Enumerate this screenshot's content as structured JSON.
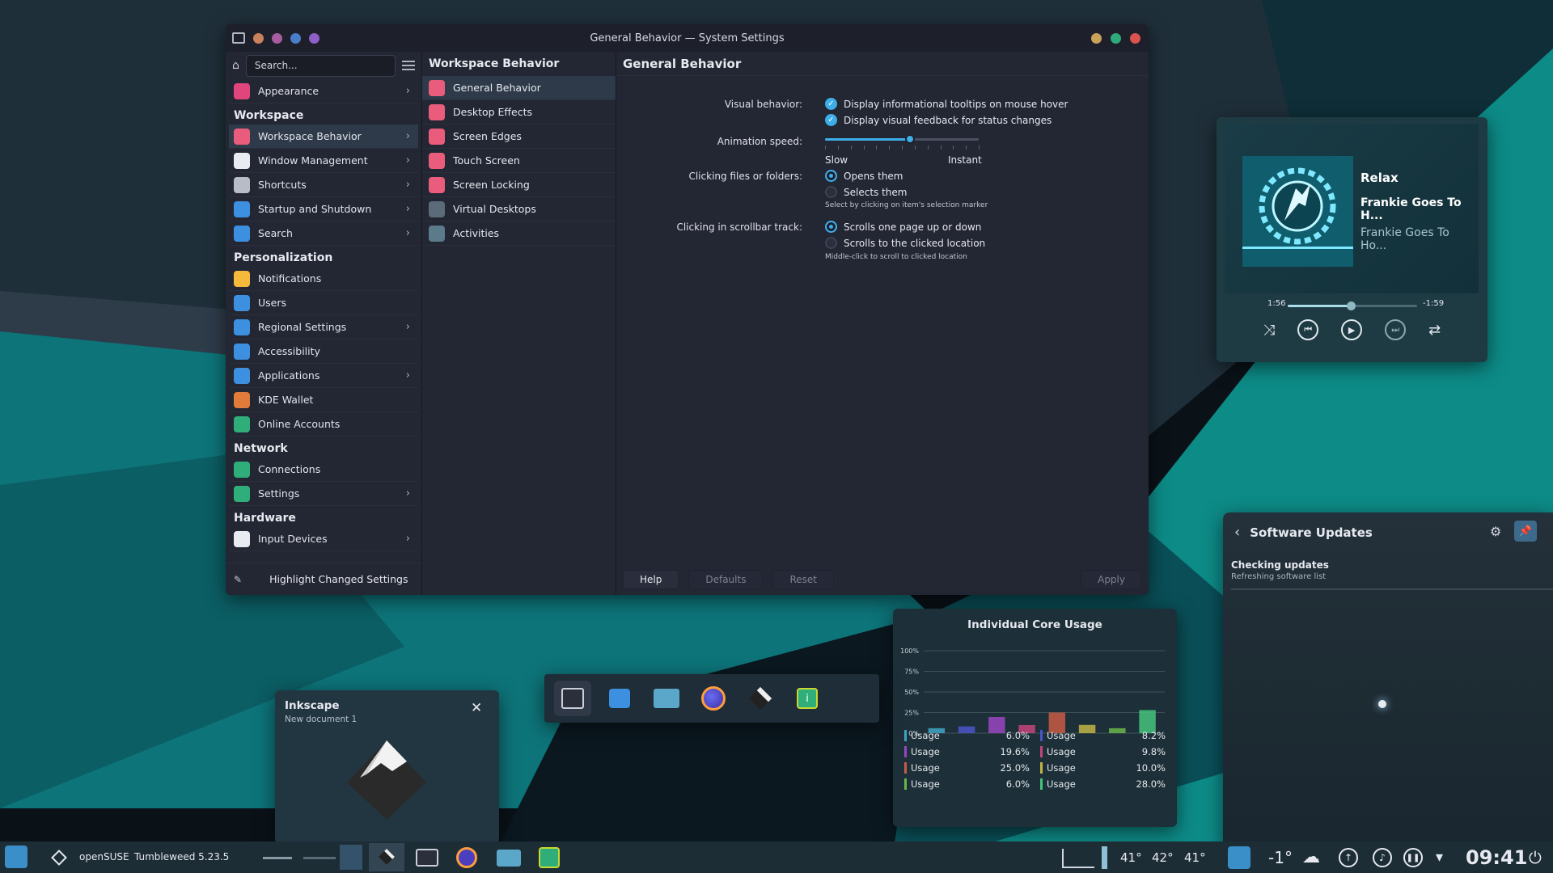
{
  "settings": {
    "title": "General Behavior — System Settings",
    "search_placeholder": "Search...",
    "sidebar": {
      "items": [
        {
          "type": "item",
          "label": "Appearance",
          "chevron": true,
          "color": "#e0457b"
        },
        {
          "type": "category",
          "label": "Workspace"
        },
        {
          "type": "item",
          "label": "Workspace Behavior",
          "chevron": true,
          "selected": true,
          "color": "#e95c7c"
        },
        {
          "type": "item",
          "label": "Window Management",
          "chevron": true,
          "color": "#e8ecf2"
        },
        {
          "type": "item",
          "label": "Shortcuts",
          "chevron": true,
          "color": "#b8bcc6"
        },
        {
          "type": "item",
          "label": "Startup and Shutdown",
          "chevron": true,
          "color": "#3d8fe0"
        },
        {
          "type": "item",
          "label": "Search",
          "chevron": true,
          "color": "#3d8fe0"
        },
        {
          "type": "category",
          "label": "Personalization"
        },
        {
          "type": "item",
          "label": "Notifications",
          "chevron": false,
          "color": "#f6b93b"
        },
        {
          "type": "item",
          "label": "Users",
          "chevron": false,
          "color": "#3d8fe0"
        },
        {
          "type": "item",
          "label": "Regional Settings",
          "chevron": true,
          "color": "#3d8fe0"
        },
        {
          "type": "item",
          "label": "Accessibility",
          "chevron": false,
          "color": "#3d8fe0"
        },
        {
          "type": "item",
          "label": "Applications",
          "chevron": true,
          "color": "#3d8fe0"
        },
        {
          "type": "item",
          "label": "KDE Wallet",
          "chevron": false,
          "color": "#e07b39"
        },
        {
          "type": "item",
          "label": "Online Accounts",
          "chevron": false,
          "color": "#2fae7a"
        },
        {
          "type": "category",
          "label": "Network"
        },
        {
          "type": "item",
          "label": "Connections",
          "chevron": false,
          "color": "#2fae7a"
        },
        {
          "type": "item",
          "label": "Settings",
          "chevron": true,
          "color": "#2fae7a"
        },
        {
          "type": "category",
          "label": "Hardware"
        },
        {
          "type": "item",
          "label": "Input Devices",
          "chevron": true,
          "color": "#e8ecf2"
        }
      ],
      "footer": "Highlight Changed Settings"
    },
    "subpanel": {
      "title": "Workspace Behavior",
      "items": [
        "General Behavior",
        "Desktop Effects",
        "Screen Edges",
        "Touch Screen",
        "Screen Locking",
        "Virtual Desktops",
        "Activities"
      ]
    },
    "content": {
      "title": "General Behavior",
      "visual_label": "Visual behavior:",
      "visual_opt1": "Display informational tooltips on mouse hover",
      "visual_opt2": "Display visual feedback for status changes",
      "anim_label": "Animation speed:",
      "anim_level": 0.55,
      "anim_slow": "Slow",
      "anim_instant": "Instant",
      "click_label": "Clicking files or folders:",
      "click_opt1": "Opens them",
      "click_opt2": "Selects them",
      "click_hint": "Select by clicking on item's selection marker",
      "scroll_label": "Clicking in scrollbar track:",
      "scroll_opt1": "Scrolls one page up or down",
      "scroll_opt2": "Scrolls to the clicked location",
      "scroll_hint": "Middle-click to scroll to clicked location"
    },
    "buttons": {
      "help": "Help",
      "defaults": "Defaults",
      "reset": "Reset",
      "apply": "Apply"
    }
  },
  "media": {
    "title": "Relax",
    "artist": "Frankie Goes To H...",
    "album": "Frankie Goes To Ho...",
    "elapsed": "1:56",
    "remaining": "-1:59",
    "progress": 0.49
  },
  "updates": {
    "title": "Software Updates",
    "status": "Checking updates",
    "substatus": "Refreshing software list"
  },
  "cores": {
    "title": "Individual Core Usage",
    "legend_label": "Usage",
    "legend_values": [
      "6.0%",
      "8.2%",
      "19.6%",
      "9.8%",
      "25.0%",
      "10.0%",
      "6.0%",
      "28.0%"
    ]
  },
  "chart_data": {
    "type": "bar",
    "title": "Individual Core Usage",
    "yticks": [
      "100%",
      "75%",
      "50%",
      "25%",
      "0%"
    ],
    "ylim": [
      0,
      100
    ],
    "series": [
      {
        "name": "Usage",
        "values": [
          6.0,
          8.2,
          19.6,
          9.8,
          25.0,
          10.0,
          6.0,
          28.0
        ]
      }
    ],
    "colors": [
      "#3fa4c4",
      "#4a55c8",
      "#9b45c2",
      "#c2457b",
      "#c95b45",
      "#c2b445",
      "#6bb54a",
      "#45c27b"
    ]
  },
  "inkscape": {
    "title": "Inkscape",
    "subtitle": "New document 1"
  },
  "dock": {
    "icons": [
      "settings-icon",
      "discover-icon",
      "folder-icon",
      "firefox-icon",
      "inkscape-icon",
      "info-center-icon"
    ]
  },
  "taskbar": {
    "distro": "openSUSE",
    "version": "Tumbleweed 5.23.5",
    "temps": [
      "41°",
      "42°",
      "41°"
    ],
    "weather": "-1°",
    "clock": "09:41"
  }
}
